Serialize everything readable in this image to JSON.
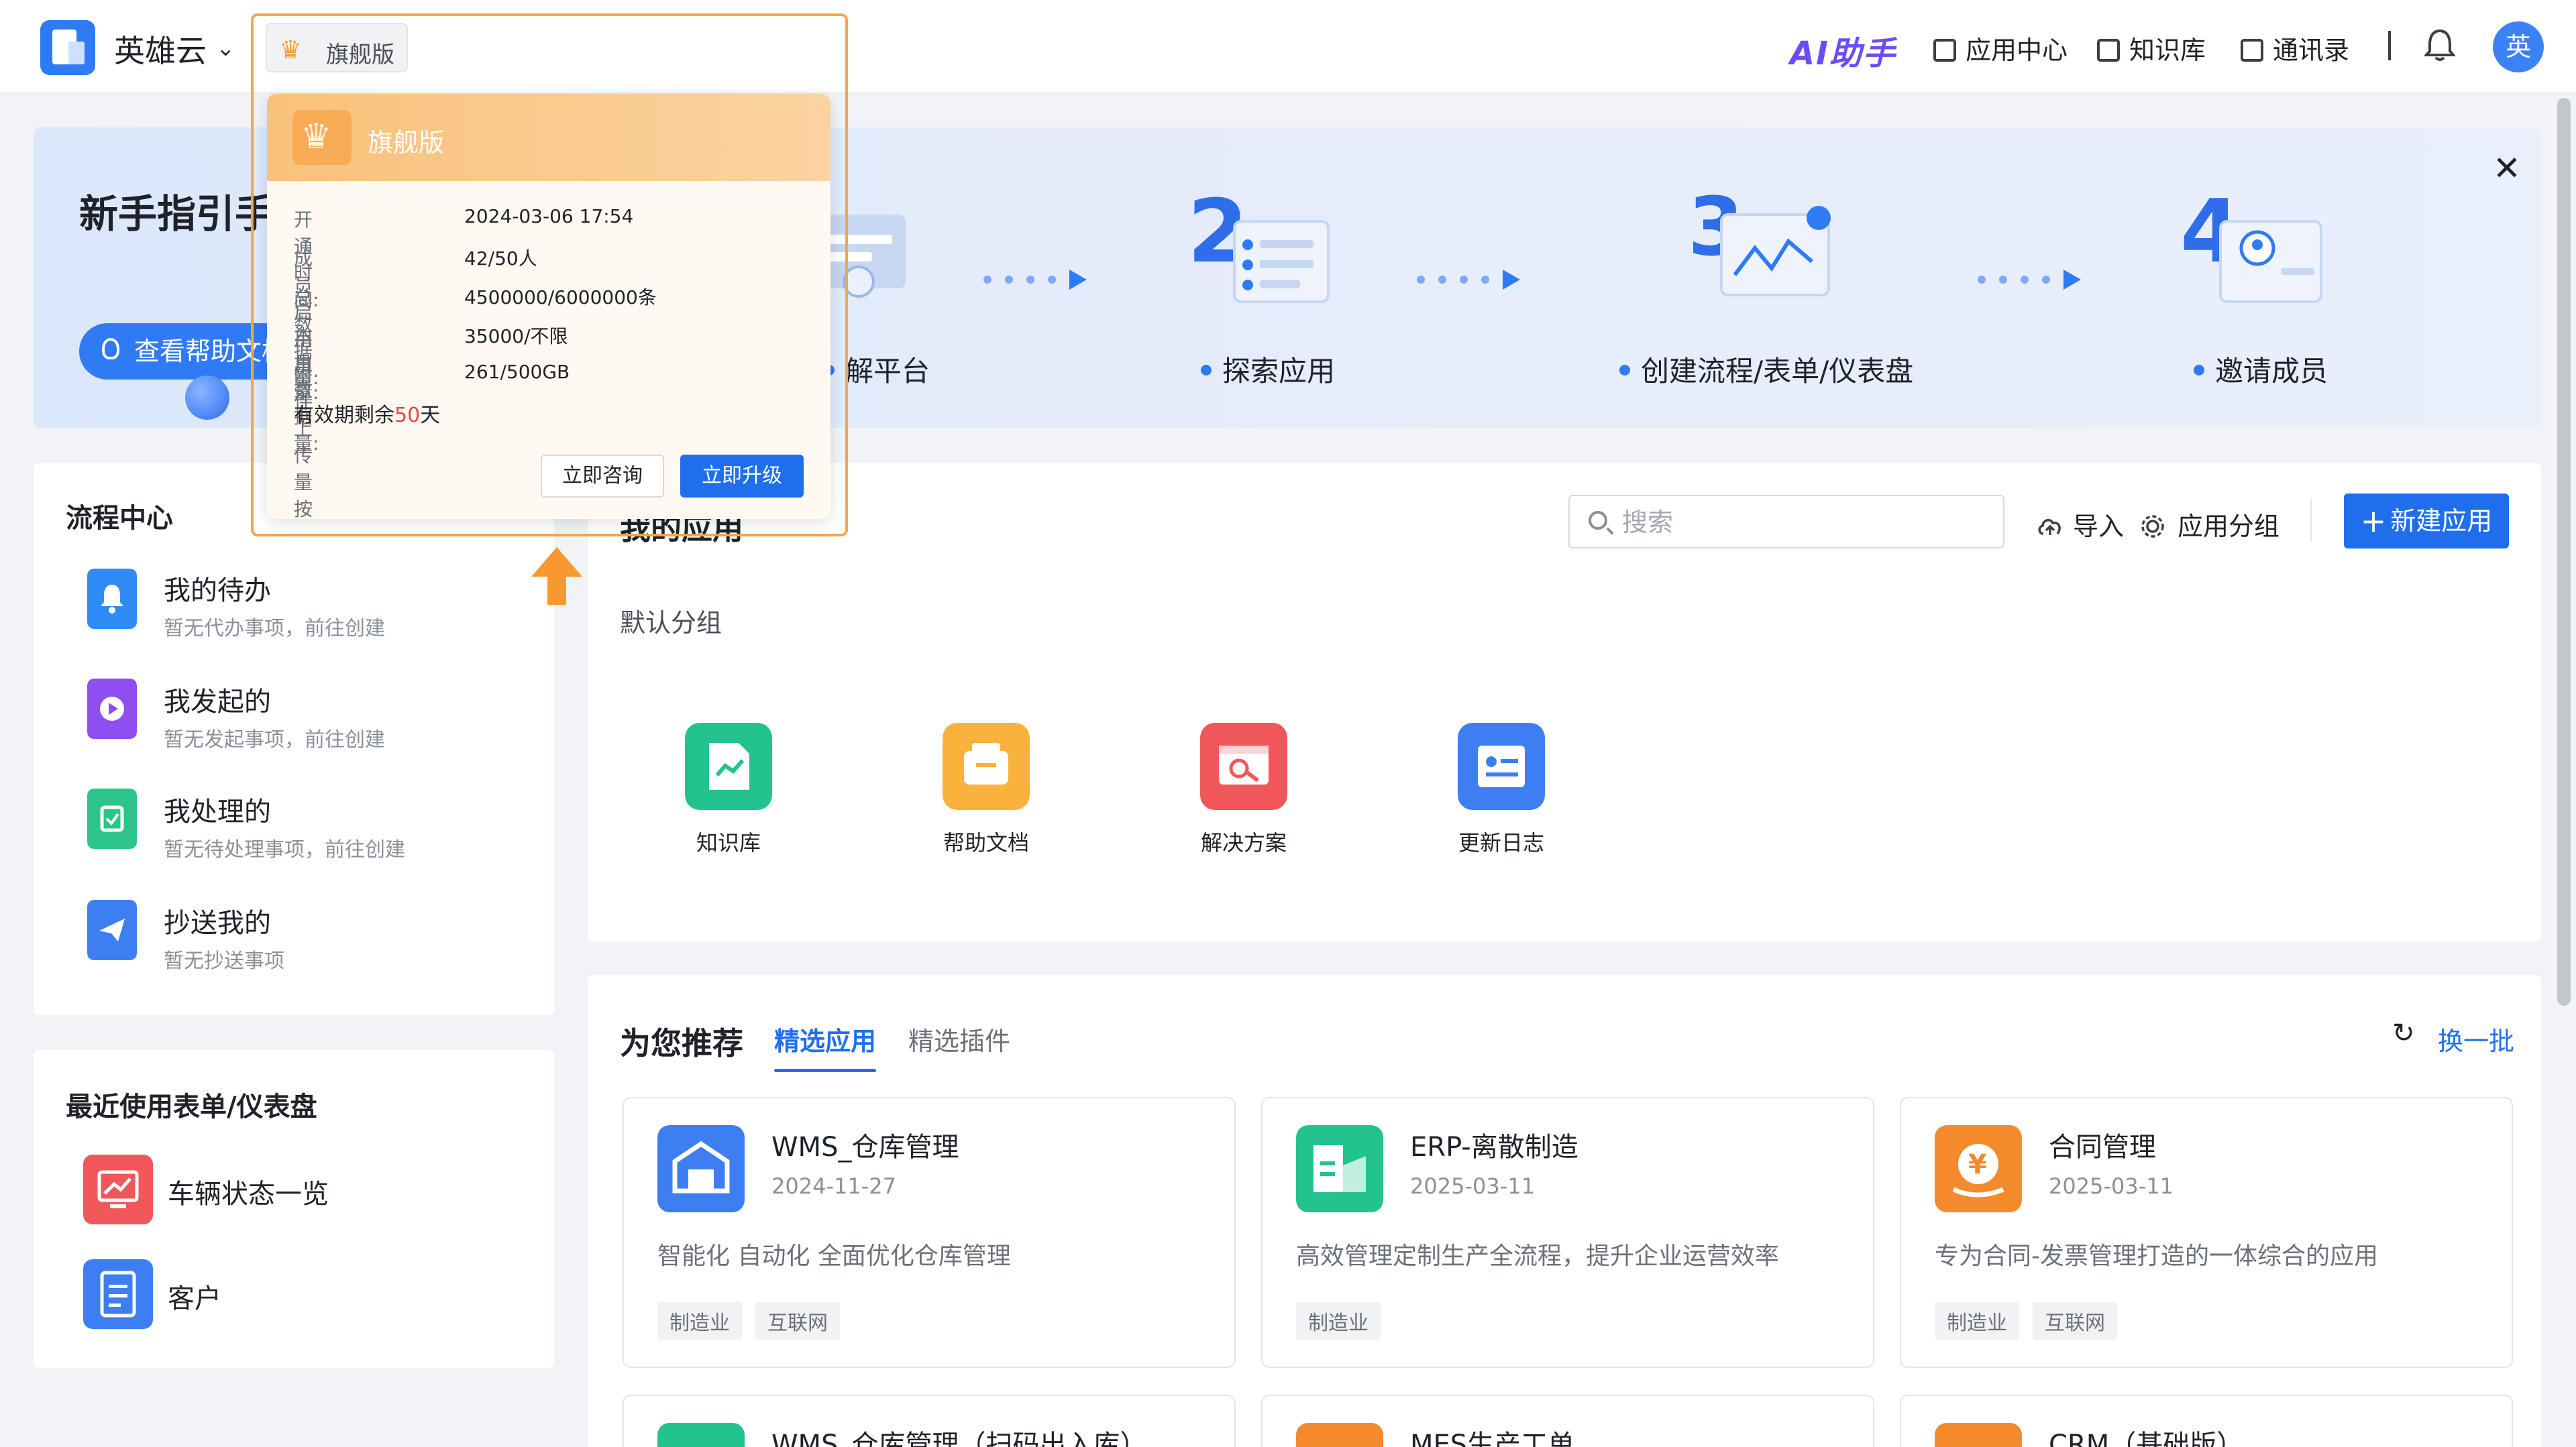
{
  "header": {
    "brand_name": "英雄云",
    "edition_chip": "旗舰版",
    "ai_helper": "AI助手",
    "nav": [
      {
        "label": "应用中心",
        "icon": "app-center-icon"
      },
      {
        "label": "知识库",
        "icon": "book-icon"
      },
      {
        "label": "通讯录",
        "icon": "contacts-icon"
      }
    ],
    "avatar_text": "英"
  },
  "guide": {
    "title": "新手指引手",
    "help_button": "查看帮助文档",
    "steps": [
      {
        "label": "解平台"
      },
      {
        "label": "探索应用"
      },
      {
        "label": "创建流程/表单/仪表盘"
      },
      {
        "label": "邀请成员"
      }
    ]
  },
  "flow_center": {
    "title": "流程中心",
    "items": [
      {
        "name": "我的待办",
        "desc": "暂无代办事项，前往创建",
        "color": "#2f8cf6"
      },
      {
        "name": "我发起的",
        "desc": "暂无发起事项，前往创建",
        "color": "#8e4ef0"
      },
      {
        "name": "我处理的",
        "desc": "暂无待处理事项，前往创建",
        "color": "#2cc48b"
      },
      {
        "name": "抄送我的",
        "desc": "暂无抄送事项",
        "color": "#3d7ff2"
      }
    ]
  },
  "recent": {
    "title": "最近使用表单/仪表盘",
    "items": [
      {
        "name": "车辆状态一览",
        "color": "#f0575a"
      },
      {
        "name": "客户",
        "color": "#3d7ff2"
      }
    ]
  },
  "my_apps": {
    "title": "我的应用",
    "search_placeholder": "搜索",
    "import_label": "导入",
    "group_label_btn": "应用分组",
    "new_app": "新建应用",
    "default_group": "默认分组",
    "apps": [
      {
        "name": "知识库",
        "color": "#22c38e"
      },
      {
        "name": "帮助文档",
        "color": "#f9b33c"
      },
      {
        "name": "解决方案",
        "color": "#f0575a"
      },
      {
        "name": "更新日志",
        "color": "#3d7ff2"
      }
    ]
  },
  "recommend": {
    "title": "为您推荐",
    "tabs": [
      "精选应用",
      "精选插件"
    ],
    "refresh": "换一批",
    "cards": [
      {
        "name": "WMS_仓库管理",
        "date": "2024-11-27",
        "desc": "智能化 自动化 全面优化仓库管理",
        "tags": [
          "制造业",
          "互联网"
        ],
        "color": "#3d7ff2"
      },
      {
        "name": "ERP-离散制造",
        "date": "2025-03-11",
        "desc": "高效管理定制生产全流程，提升企业运营效率",
        "tags": [
          "制造业"
        ],
        "color": "#22c38e"
      },
      {
        "name": "合同管理",
        "date": "2025-03-11",
        "desc": "专为合同-发票管理打造的一体综合的应用",
        "tags": [
          "制造业",
          "互联网"
        ],
        "color": "#f58a2c"
      }
    ],
    "partial_cards": [
      {
        "name": "WMS_仓库管理（扫码出入库）",
        "color": "#22c38e"
      },
      {
        "name": "MES生产工单",
        "color": "#f58a2c"
      },
      {
        "name": "CRM（基础版）",
        "color": "#f58a2c"
      }
    ]
  },
  "popover": {
    "title": "旗舰版",
    "rows": [
      {
        "k": "开通时间:",
        "v": "2024-03-06 17:54"
      },
      {
        "k": "成员启用用量:",
        "v": "42/50人"
      },
      {
        "k": "总数据量:",
        "v": "4500000/6000000条"
      },
      {
        "k": "本月数据量:",
        "v": "35000/不限"
      },
      {
        "k": "附件上传量按年:",
        "v": "261/500GB"
      }
    ],
    "valid_prefix": "有效期剩余",
    "valid_days": "50",
    "valid_suffix": "天",
    "consult": "立即咨询",
    "upgrade": "立即升级"
  }
}
